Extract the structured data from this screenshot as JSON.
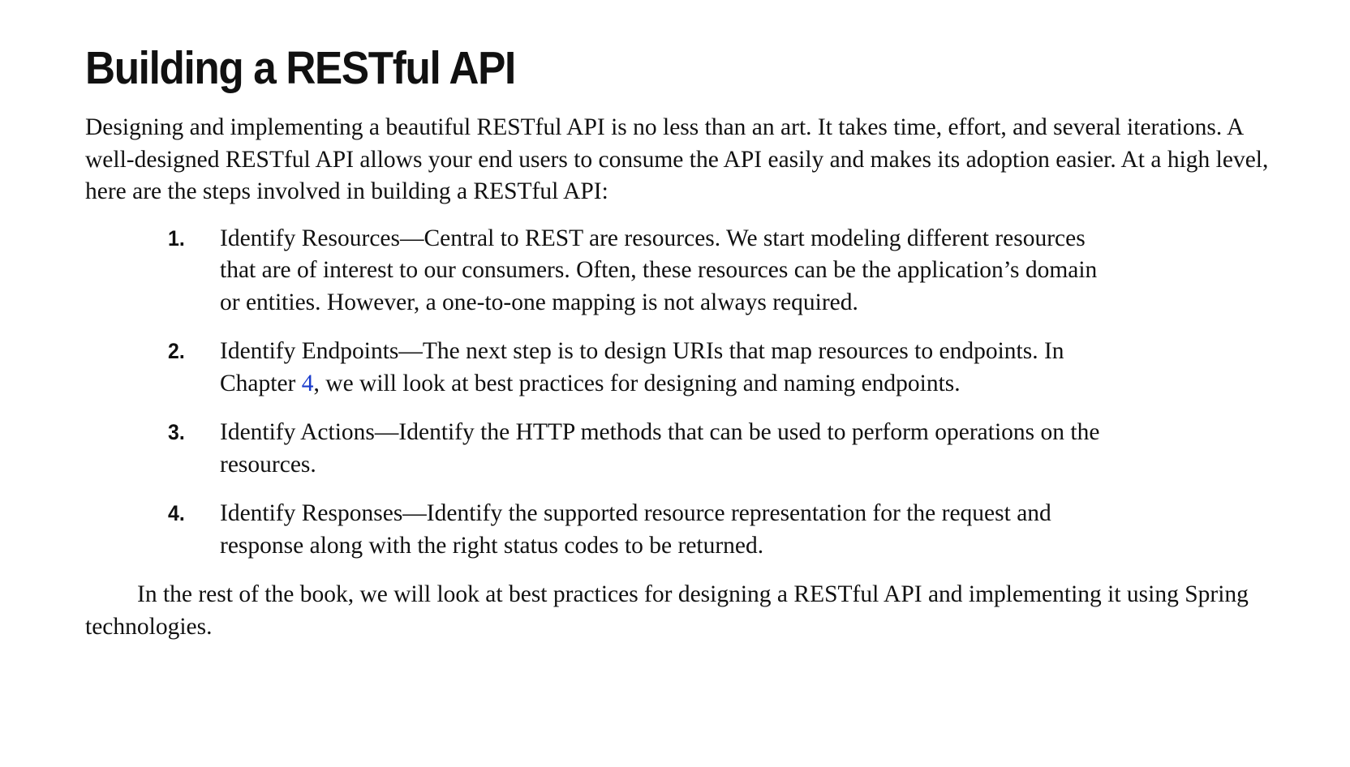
{
  "heading": "Building a RESTful API",
  "intro": "Designing and implementing a beautiful RESTful API is no less than an art. It takes time, effort, and several iterations. A well-designed RESTful API allows your end users to consume the API easily and makes its adoption easier. At a high level, here are the steps involved in building a RESTful API:",
  "steps": [
    {
      "number": "1.",
      "text": "Identify Resources—Central to REST are resources. We start modeling different resources that are of interest to our consumers. Often, these resources can be the application’s domain or entities. However, a one-to-one mapping is not always required."
    },
    {
      "number": "2.",
      "text_before": "Identify Endpoints—The next step is to design URIs that map resources to endpoints. In Chapter ",
      "link": "4",
      "text_after": ", we will look at best practices for designing and naming endpoints."
    },
    {
      "number": "3.",
      "text": "Identify Actions—Identify the HTTP methods that can be used to perform operations on the resources."
    },
    {
      "number": "4.",
      "text": "Identify Responses—Identify the supported resource representation for the request and response along with the right status codes to be returned."
    }
  ],
  "closing": "In the rest of the book, we will look at best practices for designing a RESTful API and implementing it using Spring technologies.",
  "colors": {
    "text": "#111111",
    "link": "#1a3ccc",
    "background": "#ffffff"
  }
}
